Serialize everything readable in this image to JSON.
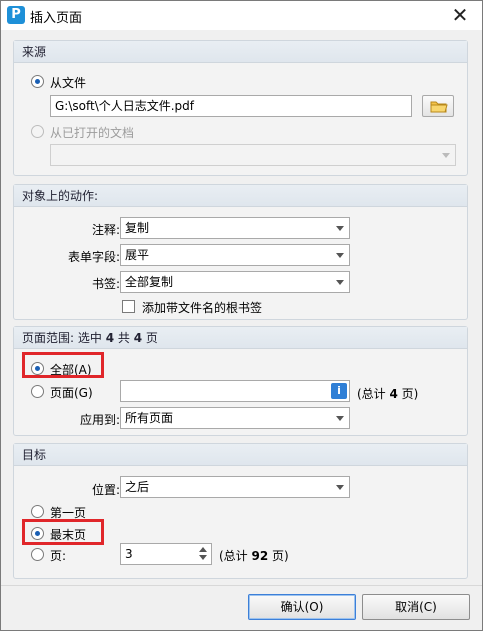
{
  "window": {
    "title": "插入页面",
    "app_icon_letter": "P"
  },
  "source": {
    "header": "来源",
    "from_file_label": "从文件",
    "file_path": "G:\\soft\\个人日志文件.pdf",
    "from_open_doc_label": "从已打开的文档",
    "open_doc_value": ""
  },
  "actions": {
    "header": "对象上的动作:",
    "annotations_label": "注释:",
    "annotations_value": "复制",
    "form_fields_label": "表单字段:",
    "form_fields_value": "展平",
    "bookmarks_label": "书签:",
    "bookmarks_value": "全部复制",
    "root_bookmark_label": "添加带文件名的根书签"
  },
  "page_range": {
    "header_prefix": "页面范围: 选中 ",
    "selected_count": "4",
    "header_mid": " 共 ",
    "total_count": "4",
    "header_suffix": " 页",
    "all_label": "全部(A)",
    "pages_label": "页面(G)",
    "pages_value": "",
    "total_prefix": "(总计 ",
    "total_pages": "4",
    "total_suffix": " 页)",
    "apply_to_label": "应用到:",
    "apply_to_value": "所有页面"
  },
  "target": {
    "header": "目标",
    "position_label": "位置:",
    "position_value": "之后",
    "first_page_label": "第一页",
    "last_page_label": "最末页",
    "page_label": "页:",
    "page_value": "3",
    "total_prefix": "(总计 ",
    "total_pages": "92",
    "total_suffix": " 页)"
  },
  "buttons": {
    "ok": "确认(O)",
    "cancel": "取消(C)"
  },
  "colors": {
    "highlight": "#e0262a",
    "accent": "#1a5fb4"
  }
}
